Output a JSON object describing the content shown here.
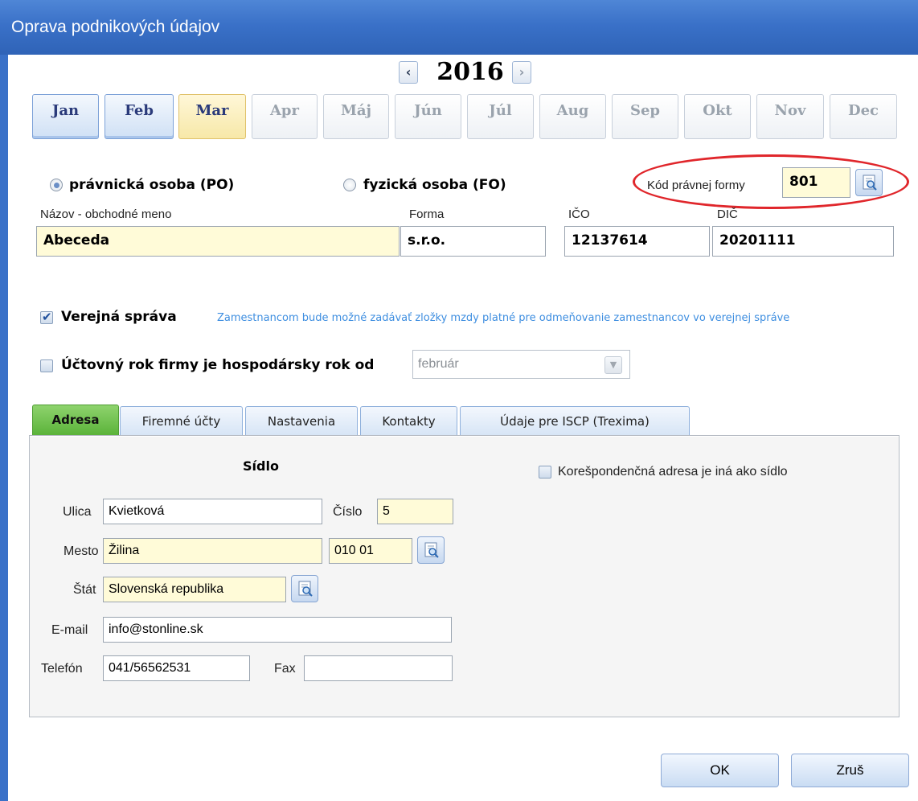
{
  "window": {
    "title": "Oprava podnikových údajov"
  },
  "year_nav": {
    "year": "2016",
    "prev_icon": "chevron-left-icon",
    "next_icon": "chevron-right-icon"
  },
  "months": [
    {
      "label": "Jan",
      "state": "active"
    },
    {
      "label": "Feb",
      "state": "active"
    },
    {
      "label": "Mar",
      "state": "current"
    },
    {
      "label": "Apr",
      "state": "inactive"
    },
    {
      "label": "Máj",
      "state": "inactive"
    },
    {
      "label": "Jún",
      "state": "inactive"
    },
    {
      "label": "Júl",
      "state": "inactive"
    },
    {
      "label": "Aug",
      "state": "inactive"
    },
    {
      "label": "Sep",
      "state": "inactive"
    },
    {
      "label": "Okt",
      "state": "inactive"
    },
    {
      "label": "Nov",
      "state": "inactive"
    },
    {
      "label": "Dec",
      "state": "inactive"
    }
  ],
  "entity_type": {
    "po_label": "právnická osoba (PO)",
    "fo_label": "fyzická osoba (FO)",
    "selected": "PO"
  },
  "legal_form_code": {
    "label": "Kód právnej formy",
    "value": "801"
  },
  "company": {
    "name_label": "Názov - obchodné meno",
    "name_value": "Abeceda",
    "form_label": "Forma",
    "form_value": "s.r.o.",
    "ico_label": "IČO",
    "ico_value": "12137614",
    "dic_label": "DIČ",
    "dic_value": "20201111"
  },
  "public_admin": {
    "label": "Verejná správa",
    "checked": true,
    "hint": "Zamestnancom bude možné zadávať zložky mzdy platné pre odmeňovanie zamestnancov vo verejnej správe"
  },
  "fiscal_year": {
    "label": "Účtovný rok firmy je hospodársky rok od",
    "checked": false,
    "month_value": "február"
  },
  "tabs": [
    {
      "label": "Adresa",
      "active": true
    },
    {
      "label": "Firemné účty",
      "active": false
    },
    {
      "label": "Nastavenia",
      "active": false
    },
    {
      "label": "Kontakty",
      "active": false
    },
    {
      "label": "Údaje pre ISCP (Trexima)",
      "active": false
    }
  ],
  "address": {
    "section_title": "Sídlo",
    "street_label": "Ulica",
    "street_value": "Kvietková",
    "number_label": "Číslo",
    "number_value": "5",
    "city_label": "Mesto",
    "city_value": "Žilina",
    "zip_value": "010 01",
    "country_label": "Štát",
    "country_value": "Slovenská republika",
    "email_label": "E-mail",
    "email_value": "info@stonline.sk",
    "phone_label": "Telefón",
    "phone_value": "041/56562531",
    "fax_label": "Fax",
    "fax_value": "",
    "correspondence_label": "Korešpondenčná adresa je iná ako sídlo",
    "correspondence_checked": false
  },
  "buttons": {
    "ok": "OK",
    "cancel": "Zruš"
  },
  "colors": {
    "titlebar": "#3a71c8",
    "highlight": "#e0262b",
    "active_tab": "#5bb33a",
    "required_field": "#fffbd8"
  }
}
